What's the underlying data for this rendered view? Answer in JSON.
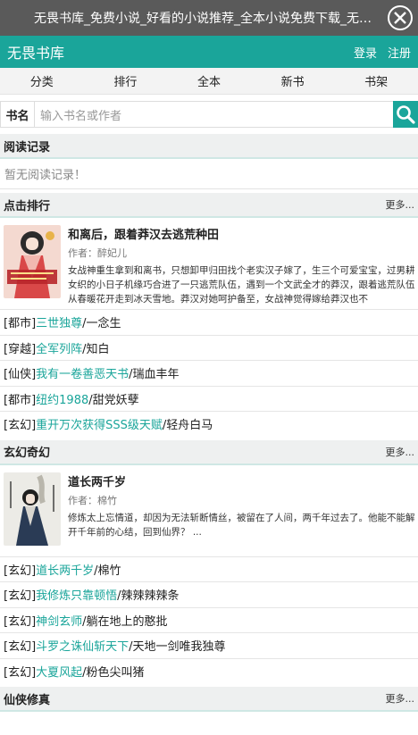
{
  "window": {
    "title": "无畏书库_免费小说_好看的小说推荐_全本小说免费下载_无畏书库"
  },
  "header": {
    "logo": "无畏书库",
    "login": "登录",
    "register": "注册"
  },
  "nav": {
    "items": [
      "分类",
      "排行",
      "全本",
      "新书",
      "书架"
    ]
  },
  "search": {
    "label": "书名",
    "placeholder": "输入书名或作者"
  },
  "reading": {
    "title": "阅读记录",
    "empty": "暂无阅读记录！"
  },
  "sections": [
    {
      "title": "点击排行",
      "more": "更多...",
      "feature": {
        "title": "和离后，跟着莽汉去逃荒种田",
        "author": "作者：醉妃儿",
        "desc": "女战神重生拿到和离书，只想卸甲归田找个老实汉子嫁了，生三个可爱宝宝，过男耕女织的小日子机缘巧合进了一只逃荒队伍，遇到一个文武全才的莽汉，跟着逃荒队伍从春暖花开走到冰天雪地。莽汉对她呵护备至，女战神觉得嫁给莽汉也不"
      },
      "rows": [
        {
          "tag": "[都市]",
          "name": "三世独尊",
          "author": "/一念生"
        },
        {
          "tag": "[穿越]",
          "name": "全军列阵",
          "author": "/知白"
        },
        {
          "tag": "[仙侠]",
          "name": "我有一卷善恶天书",
          "author": "/瑞血丰年"
        },
        {
          "tag": "[都市]",
          "name": "纽约1988",
          "author": "/甜党妖孽"
        },
        {
          "tag": "[玄幻]",
          "name": "重开万次获得SSS级天赋",
          "author": "/轻舟白马"
        }
      ]
    },
    {
      "title": "玄幻奇幻",
      "more": "更多...",
      "feature": {
        "title": "道长两千岁",
        "author": "作者：棉竹",
        "desc": "修炼太上忘情道，却因为无法斩断情丝，被留在了人间，两千年过去了。他能不能解开千年前的心结，回到仙界？ ..."
      },
      "rows": [
        {
          "tag": "[玄幻]",
          "name": "道长两千岁",
          "author": "/棉竹"
        },
        {
          "tag": "[玄幻]",
          "name": "我修炼只靠顿悟",
          "author": "/辣辣辣辣条"
        },
        {
          "tag": "[玄幻]",
          "name": "神剑玄师",
          "author": "/躺在地上的憨批"
        },
        {
          "tag": "[玄幻]",
          "name": "斗罗之诛仙斩天下",
          "author": "/天地一剑唯我独尊"
        },
        {
          "tag": "[玄幻]",
          "name": "大夏风起",
          "author": "/粉色尖叫猪"
        }
      ]
    },
    {
      "title": "仙侠修真",
      "more": "更多..."
    }
  ],
  "colors": {
    "accent": "#1aa59a",
    "titlebar": "#5a5a5a"
  }
}
